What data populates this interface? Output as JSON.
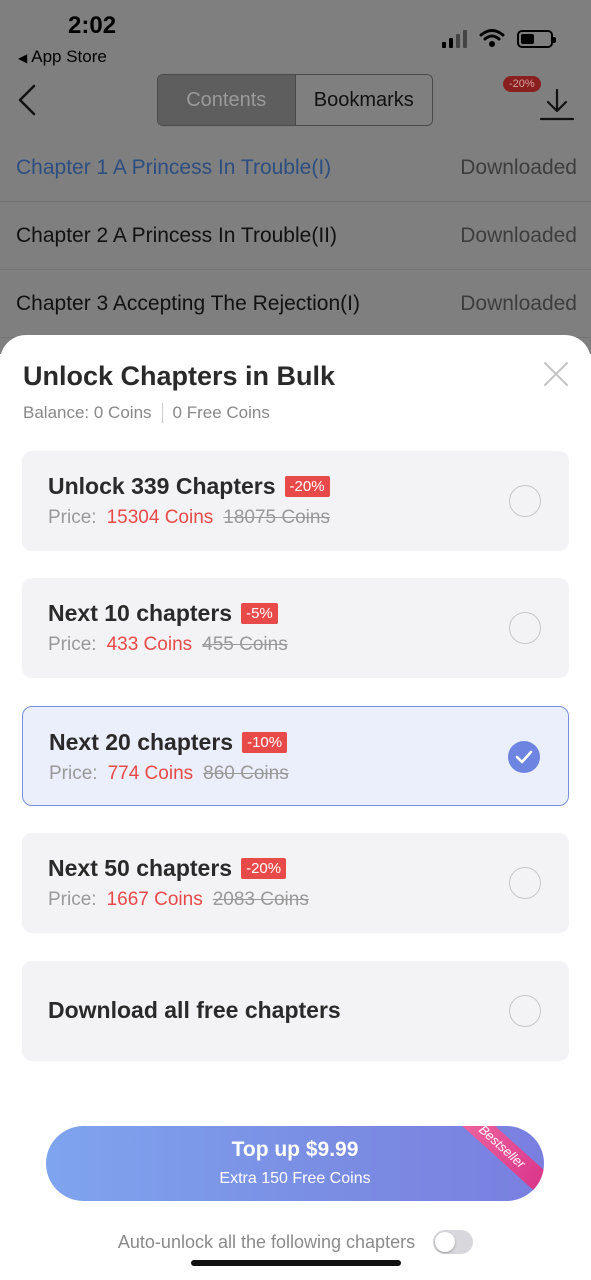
{
  "status_bar": {
    "time": "2:02",
    "back_label": "App Store"
  },
  "header": {
    "tabs": [
      {
        "label": "Contents"
      },
      {
        "label": "Bookmarks"
      }
    ],
    "download_badge": "-20%"
  },
  "chapters": [
    {
      "title": "Chapter 1 A Princess In Trouble(I)",
      "status": "Downloaded"
    },
    {
      "title": "Chapter 2 A Princess In Trouble(II)",
      "status": "Downloaded"
    },
    {
      "title": "Chapter 3 Accepting The Rejection(I)",
      "status": "Downloaded"
    }
  ],
  "sheet": {
    "title": "Unlock Chapters in Bulk",
    "balance": "Balance: 0 Coins",
    "free_balance": "0 Free Coins",
    "price_label": "Price:",
    "options": [
      {
        "title": "Unlock 339 Chapters",
        "badge": "-20%",
        "price": "15304 Coins",
        "original": "18075 Coins",
        "selected": false
      },
      {
        "title": "Next 10 chapters",
        "badge": "-5%",
        "price": "433 Coins",
        "original": "455 Coins",
        "selected": false
      },
      {
        "title": "Next 20 chapters",
        "badge": "-10%",
        "price": "774 Coins",
        "original": "860 Coins",
        "selected": true
      },
      {
        "title": "Next 50 chapters",
        "badge": "-20%",
        "price": "1667 Coins",
        "original": "2083 Coins",
        "selected": false
      },
      {
        "title": "Download all free chapters",
        "selected": false
      }
    ],
    "topup": {
      "label": "Top up $9.99",
      "sub": "Extra 150 Free Coins",
      "ribbon": "Bestseller"
    },
    "auto_unlock": {
      "label": "Auto-unlock all the following chapters",
      "enabled": false
    }
  }
}
